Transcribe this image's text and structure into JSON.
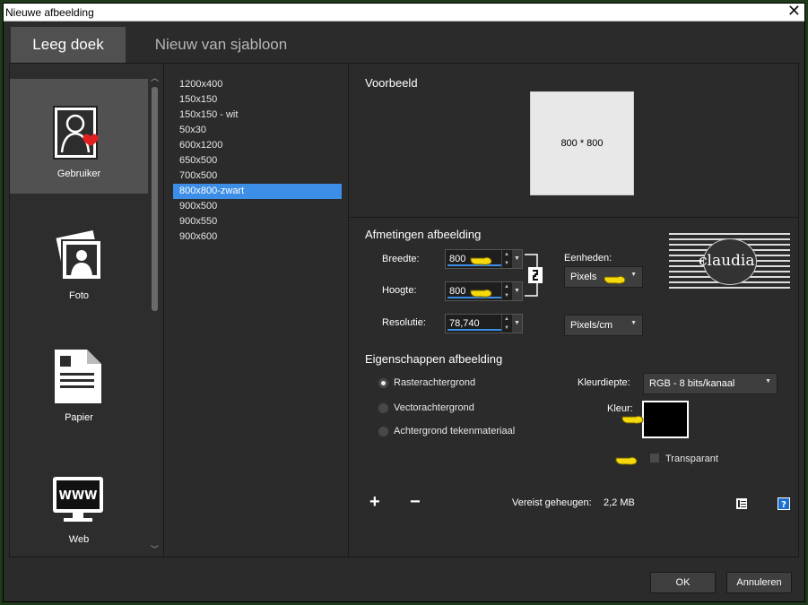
{
  "window": {
    "title": "Nieuwe afbeelding",
    "close": "✕"
  },
  "tabs": [
    {
      "label": "Leeg doek",
      "active": true
    },
    {
      "label": "Nieuw van sjabloon",
      "active": false
    }
  ],
  "categories": [
    {
      "label": "Gebruiker",
      "icon": "user-heart-icon",
      "selected": true
    },
    {
      "label": "Foto",
      "icon": "photo-person-icon",
      "selected": false
    },
    {
      "label": "Papier",
      "icon": "paper-document-icon",
      "selected": false
    },
    {
      "label": "Web",
      "icon": "web-monitor-icon",
      "selected": false
    }
  ],
  "presets": {
    "items": [
      "1200x400",
      "150x150",
      "150x150 - wit",
      "50x30",
      "600x1200",
      "650x500",
      "700x500",
      "800x800-zwart",
      "900x500",
      "900x550",
      "900x600"
    ],
    "selected": "800x800-zwart"
  },
  "preview": {
    "heading": "Voorbeeld",
    "text": "800 * 800"
  },
  "dimensions": {
    "heading": "Afmetingen afbeelding",
    "width_label": "Breedte:",
    "width_value": "800",
    "height_label": "Hoogte:",
    "height_value": "800",
    "resolution_label": "Resolutie:",
    "resolution_value": "78,740",
    "units_label": "Eenheden:",
    "units_value": "Pixels",
    "res_units_value": "Pixels/cm"
  },
  "logo": {
    "text": "claudia"
  },
  "properties": {
    "heading": "Eigenschappen afbeelding",
    "options": [
      {
        "label": "Rasterachtergrond",
        "selected": true
      },
      {
        "label": "Vectorachtergrond",
        "selected": false
      },
      {
        "label": "Achtergrond tekenmateriaal",
        "selected": false
      }
    ],
    "depth_label": "Kleurdiepte:",
    "depth_value": "RGB - 8 bits/kanaal",
    "color_label": "Kleur:",
    "color_value": "#000000",
    "transparent_label": "Transparant",
    "transparent_checked": false
  },
  "memory": {
    "label": "Vereist geheugen:",
    "value": "2,2 MB"
  },
  "buttons": {
    "ok": "OK",
    "cancel": "Annuleren",
    "add": "+",
    "remove": "−"
  },
  "colors": {
    "accent": "#3c8ee6",
    "background": "#2b2b2b",
    "pointer_hand": "#f5d90a"
  }
}
